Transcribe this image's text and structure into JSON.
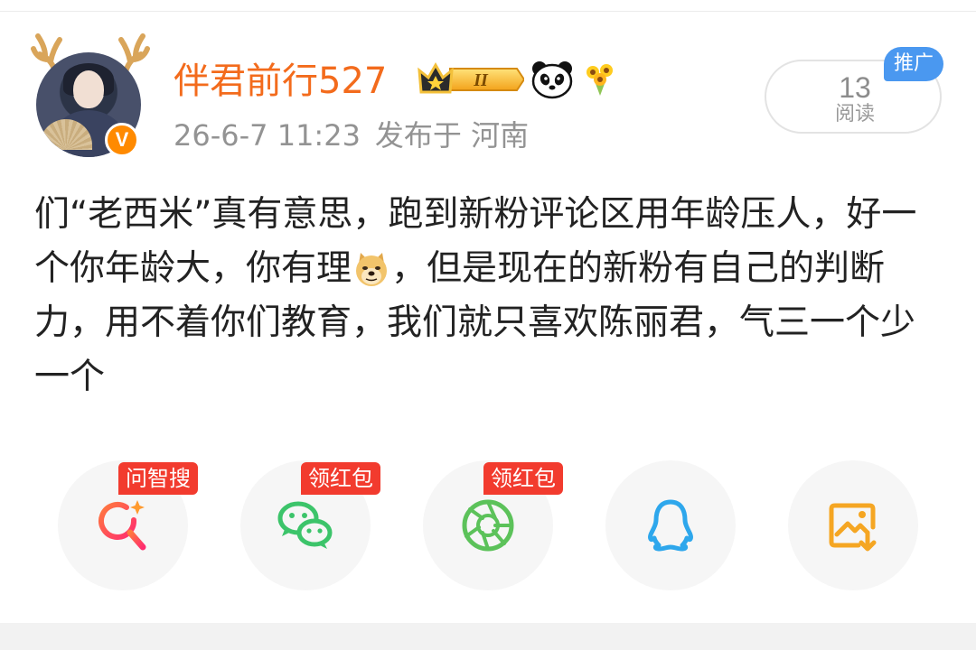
{
  "post": {
    "author": {
      "username": "伴君前行527",
      "verified_badge": "V",
      "level_badge": "II"
    },
    "timestamp": "26-6-7 11:23",
    "location": "发布于 河南",
    "read_count": "13",
    "read_label": "阅读",
    "promo_tag": "推广",
    "text_part1": "们“老西米”真有意思，跑到新粉评论区用年龄压人，好一个你年龄大，你有理",
    "text_part2": "，但是现在的新粉有自己的判断力，用不着你们教育，我们就只喜欢陈丽君，气三一个少一个"
  },
  "share": {
    "items": [
      {
        "icon": "ai-search-icon",
        "tag": "问智搜",
        "color": "#ff3b5c"
      },
      {
        "icon": "wechat-icon",
        "tag": "领红包",
        "color": "#3cc46a"
      },
      {
        "icon": "moments-icon",
        "tag": "领红包",
        "color": "#5cc25a"
      },
      {
        "icon": "qq-icon",
        "tag": "",
        "color": "#2ea7ec"
      },
      {
        "icon": "save-image-icon",
        "tag": "",
        "color": "#f5a623"
      }
    ]
  },
  "colors": {
    "username": "#f36b1c",
    "meta": "#939393",
    "promo": "#4a98f0",
    "share_tag": "#f23b2e"
  }
}
